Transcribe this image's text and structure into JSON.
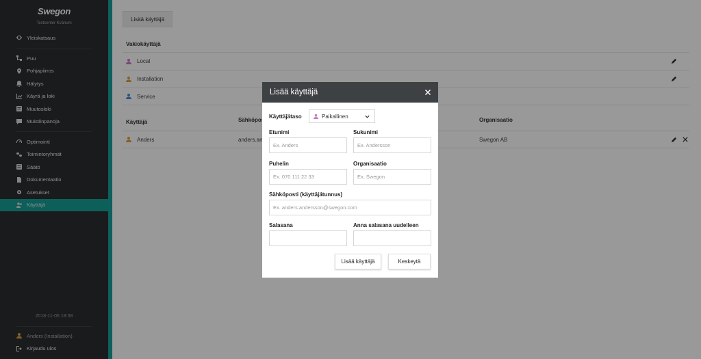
{
  "colors": {
    "sidebar_bg": "#2b2e31",
    "accent": "#18a099",
    "modal_header": "#3e4144"
  },
  "sidebar": {
    "brand": "Swegon",
    "subtitle": "Testcenter Kvänum",
    "groups": [
      [
        {
          "label": "Yleiskatsaus",
          "icon": "eye-icon"
        }
      ],
      [
        {
          "label": "Puu",
          "icon": "tree-icon"
        },
        {
          "label": "Pohjapiirros",
          "icon": "map-pin-icon"
        },
        {
          "label": "Hälytys",
          "icon": "bell-icon"
        },
        {
          "label": "Käyrä ja loki",
          "icon": "chart-line-icon"
        },
        {
          "label": "Muutosloki",
          "icon": "list-icon"
        },
        {
          "label": "Muistiinpanoja",
          "icon": "comment-icon"
        }
      ],
      [
        {
          "label": "Optimointi",
          "icon": "gauge-icon"
        },
        {
          "label": "Toimintoryhmät",
          "icon": "link-icon"
        },
        {
          "label": "Säätö",
          "icon": "sliders-icon"
        },
        {
          "label": "Dokumentaatio",
          "icon": "document-icon"
        },
        {
          "label": "Asetukset",
          "icon": "gear-icon"
        },
        {
          "label": "Käyttäjä",
          "icon": "users-icon",
          "active": true
        }
      ]
    ],
    "datetime": "2018-11-06 18:58",
    "current_user": "Anders (Installation)",
    "logout": "Kirjaudu ulos"
  },
  "main": {
    "add_user_button": "Lisää käyttäjä",
    "default_users_heading": "Vakiokäyttäjä",
    "default_users": [
      {
        "name": "Local",
        "icon": "user-icon",
        "color": "#c87bc4"
      },
      {
        "name": "Installation",
        "icon": "user-icon",
        "color": "#e0a040"
      },
      {
        "name": "Service",
        "icon": "user-icon",
        "color": "#4a90d0"
      }
    ],
    "table": {
      "headers": [
        "Käyttäjä",
        "Sähköposti",
        "Organisaatio"
      ],
      "rows": [
        {
          "name": "Anders",
          "email": "anders.and",
          "organisation": "Swegon AB"
        }
      ]
    }
  },
  "modal": {
    "title": "Lisää käyttäjä",
    "level_label": "Käyttäjätaso",
    "level_value": "Paikallinen",
    "fields": {
      "first_name": {
        "label": "Etunimi",
        "placeholder": "Ex. Anders"
      },
      "last_name": {
        "label": "Sukunimi",
        "placeholder": "Ex. Andersson"
      },
      "phone": {
        "label": "Puhelin",
        "placeholder": "Ex. 070 111 22 33"
      },
      "organisation": {
        "label": "Organisaatio",
        "placeholder": "Ex. Swegon"
      },
      "email": {
        "label": "Sähköposti (käyttäjätunnus)",
        "placeholder": "Ex. anders.andersson@swegon.com"
      },
      "password": {
        "label": "Salasana",
        "placeholder": ""
      },
      "password_repeat": {
        "label": "Anna salasana uudelleen",
        "placeholder": ""
      }
    },
    "submit": "Lisää käyttäjä",
    "cancel": "Keskeytä"
  }
}
